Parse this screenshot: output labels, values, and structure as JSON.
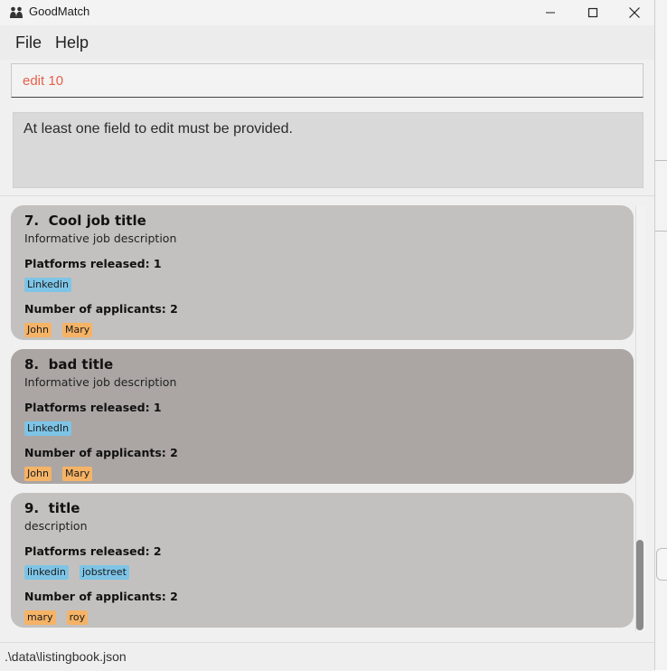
{
  "window": {
    "title": "GoodMatch"
  },
  "menu": {
    "items": [
      "File",
      "Help"
    ]
  },
  "command": {
    "value": "edit 10"
  },
  "result": {
    "message": "At least one field to edit must be provided."
  },
  "listings": [
    {
      "index": "7.",
      "title": "Cool job title",
      "description": "Informative job description",
      "platforms_label": "Platforms released: 1",
      "platforms": [
        "Linkedin"
      ],
      "applicants_label": "Number of applicants: 2",
      "applicants": [
        "John",
        "Mary"
      ]
    },
    {
      "index": "8.",
      "title": "bad title",
      "description": "Informative job description",
      "platforms_label": "Platforms released: 1",
      "platforms": [
        "LinkedIn"
      ],
      "applicants_label": "Number of applicants: 2",
      "applicants": [
        "John",
        "Mary"
      ]
    },
    {
      "index": "9.",
      "title": "title",
      "description": "description",
      "platforms_label": "Platforms released: 2",
      "platforms": [
        "linkedin",
        "jobstreet"
      ],
      "applicants_label": "Number of applicants: 2",
      "applicants": [
        "mary",
        "roy"
      ]
    }
  ],
  "status": {
    "path": ".\\data\\listingbook.json"
  },
  "colors": {
    "platform_tag": "#7ec4e6",
    "applicant_tag": "#f5b366",
    "command_text": "#e8604a"
  }
}
